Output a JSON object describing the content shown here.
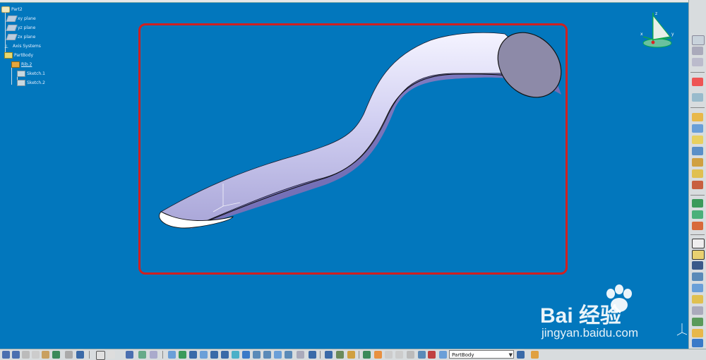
{
  "tree": {
    "root": "Part2",
    "items": [
      {
        "label": "xy plane",
        "icon": "plane"
      },
      {
        "label": "yz plane",
        "icon": "plane"
      },
      {
        "label": "zx plane",
        "icon": "plane"
      },
      {
        "label": "Axis Systems",
        "icon": "axis"
      },
      {
        "label": "PartBody",
        "icon": "body"
      },
      {
        "label": "Rib.2",
        "icon": "rib"
      },
      {
        "label": "Sketch.1",
        "icon": "sketch"
      },
      {
        "label": "Sketch.2",
        "icon": "sketch"
      }
    ]
  },
  "compass_axes": {
    "x": "x",
    "y": "y",
    "z": "z"
  },
  "toolbar": {
    "active_body": "PartBody"
  },
  "watermark": {
    "brand": "Bai  经验",
    "url": "jingyan.baidu.com"
  },
  "colors": {
    "background": "#0277bd",
    "selection_frame": "#d02020",
    "model_surface": "#c7c4ee",
    "model_shadow": "#6d6aa8",
    "end_face": "#8d8aa8"
  }
}
